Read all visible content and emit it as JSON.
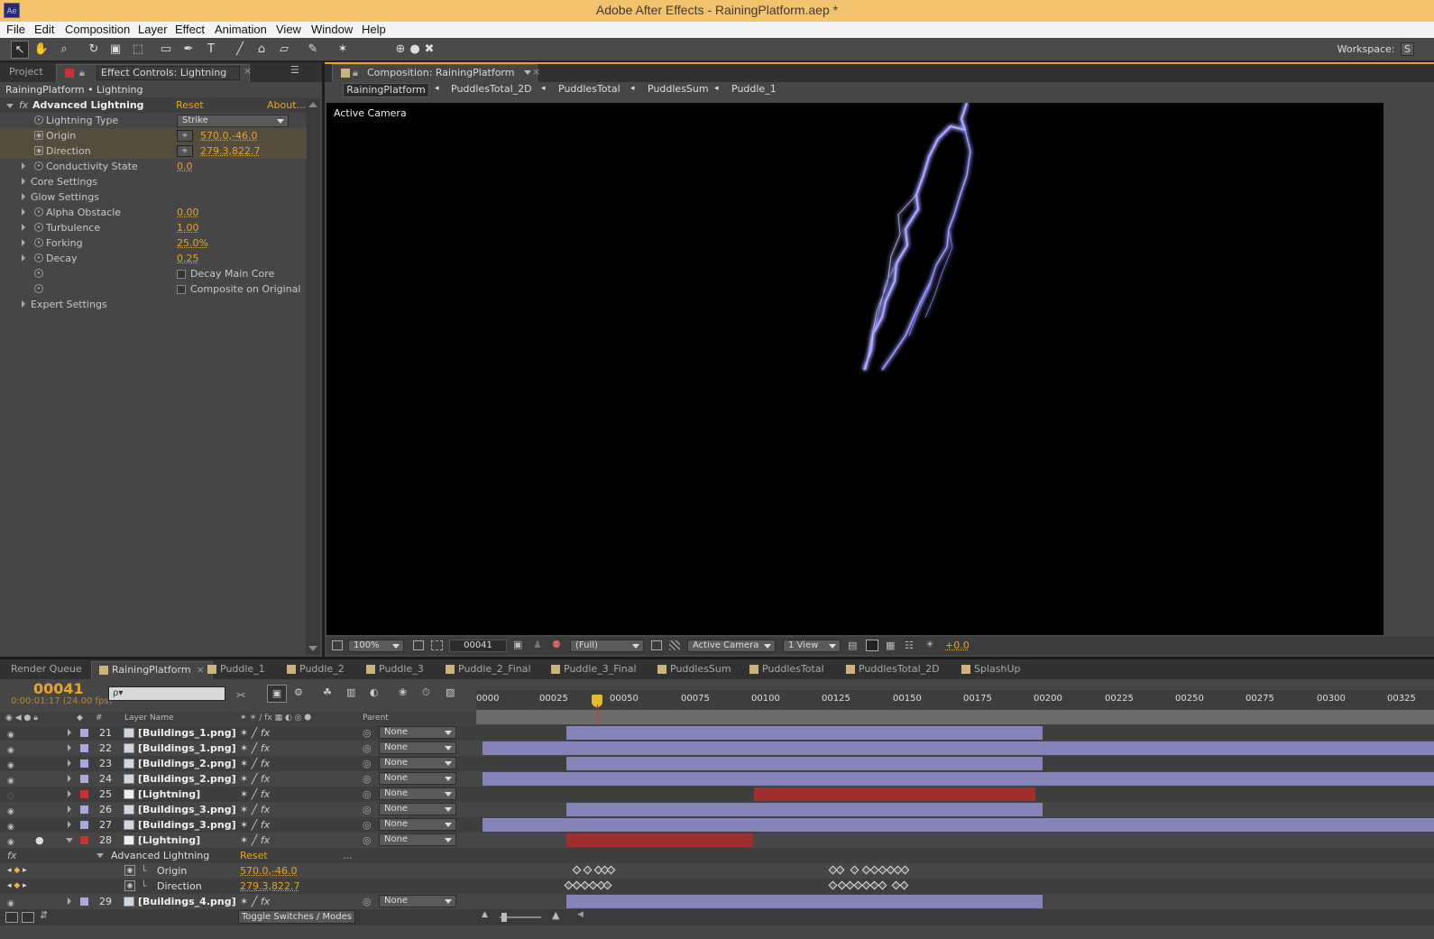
{
  "app": {
    "icon_label": "Ae",
    "title": "Adobe After Effects - RainingPlatform.aep *"
  },
  "menu": [
    "File",
    "Edit",
    "Composition",
    "Layer",
    "Effect",
    "Animation",
    "View",
    "Window",
    "Help"
  ],
  "toolbar": {
    "workspace_label": "Workspace:",
    "workspace_value": "S"
  },
  "effect_panel": {
    "tabs": {
      "project": "Project",
      "effect_controls": "Effect Controls: Lightning"
    },
    "breadcrumb": "RainingPlatform • Lightning",
    "effect": {
      "name": "Advanced Lightning",
      "reset": "Reset",
      "about": "About..."
    },
    "props": {
      "lightning_type": {
        "label": "Lightning Type",
        "value": "Strike"
      },
      "origin": {
        "label": "Origin",
        "value": "570.0,-46.0"
      },
      "direction": {
        "label": "Direction",
        "value": "279.3,822.7"
      },
      "conductivity": {
        "label": "Conductivity State",
        "value": "0.0"
      },
      "core_settings": {
        "label": "Core Settings"
      },
      "glow_settings": {
        "label": "Glow Settings"
      },
      "alpha_obstacle": {
        "label": "Alpha Obstacle",
        "value": "0.00"
      },
      "turbulence": {
        "label": "Turbulence",
        "value": "1.00"
      },
      "forking": {
        "label": "Forking",
        "value": "25.0%"
      },
      "decay": {
        "label": "Decay",
        "value": "0.25"
      },
      "decay_main_core": {
        "label": "Decay Main Core",
        "checked": false
      },
      "composite_on_original": {
        "label": "Composite on Original",
        "checked": false
      },
      "expert_settings": {
        "label": "Expert Settings"
      }
    }
  },
  "comp_panel": {
    "tab": "Composition: RainingPlatform",
    "flow": [
      "RainingPlatform",
      "PuddlesTotal_2D",
      "PuddlesTotal",
      "PuddlesSum",
      "Puddle_1"
    ],
    "viewer_label": "Active Camera",
    "footer": {
      "zoom": "100%",
      "timecode": "00041",
      "resolution": "(Full)",
      "camera": "Active Camera",
      "views": "1 View",
      "exposure": "+0.0"
    }
  },
  "timeline": {
    "tabs": [
      "Render Queue",
      "RainingPlatform",
      "Puddle_1",
      "Puddle_2",
      "Puddle_3",
      "Puddle_2_Final",
      "Puddle_3_Final",
      "PuddlesSum",
      "PuddlesTotal",
      "PuddlesTotal_2D",
      "SplashUp"
    ],
    "current_frame": "00041",
    "current_time": "0:00:01:17 (24.00 fps)",
    "search_placeholder": "ρ▾",
    "ruler": [
      "0000",
      "00025",
      "00050",
      "00075",
      "00100",
      "00125",
      "00150",
      "00175",
      "00200",
      "00225",
      "00250",
      "00275",
      "00300",
      "00325"
    ],
    "col_headers": {
      "num": "#",
      "layer_name": "Layer Name",
      "parent": "Parent"
    },
    "layers": [
      {
        "num": "21",
        "name": "[Buildings_1.png]",
        "parent": "None",
        "color": "#a9a9e0",
        "type": "png"
      },
      {
        "num": "22",
        "name": "[Buildings_1.png]",
        "parent": "None",
        "color": "#a9a9e0",
        "type": "png"
      },
      {
        "num": "23",
        "name": "[Buildings_2.png]",
        "parent": "None",
        "color": "#a9a9e0",
        "type": "png"
      },
      {
        "num": "24",
        "name": "[Buildings_2.png]",
        "parent": "None",
        "color": "#a9a9e0",
        "type": "png"
      },
      {
        "num": "25",
        "name": "[Lightning]",
        "parent": "None",
        "color": "#c83232",
        "type": "solid"
      },
      {
        "num": "26",
        "name": "[Buildings_3.png]",
        "parent": "None",
        "color": "#a9a9e0",
        "type": "png"
      },
      {
        "num": "27",
        "name": "[Buildings_3.png]",
        "parent": "None",
        "color": "#a9a9e0",
        "type": "png"
      },
      {
        "num": "28",
        "name": "[Lightning]",
        "parent": "None",
        "color": "#c83232",
        "type": "solid"
      }
    ],
    "expanded": {
      "effect": "Advanced Lightning",
      "reset": "Reset",
      "dots": "...",
      "origin": {
        "label": "Origin",
        "value": "570.0,-46.0"
      },
      "direction": {
        "label": "Direction",
        "value": "279.3,822.7"
      }
    },
    "last_layer": {
      "num": "29",
      "name": "[Buildings_4.png]",
      "parent": "None",
      "color": "#a9a9e0"
    },
    "toggle_label": "Toggle Switches / Modes"
  }
}
